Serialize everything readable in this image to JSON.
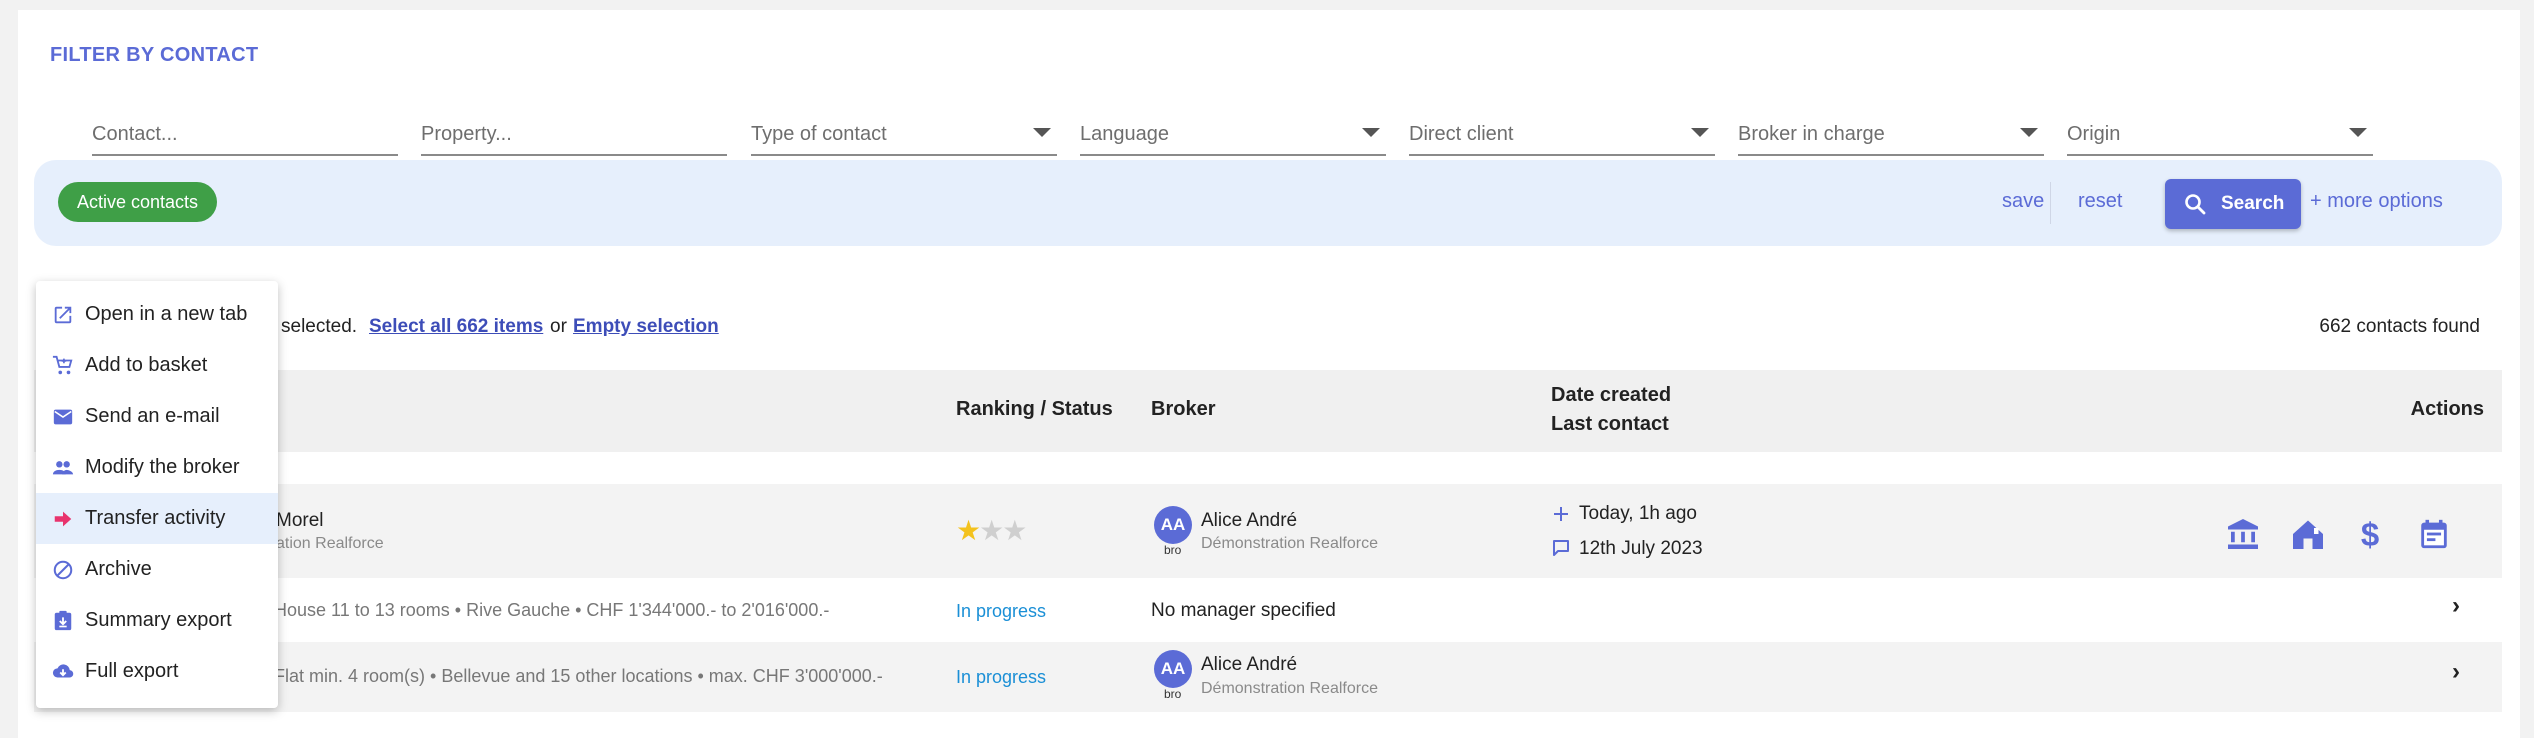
{
  "filter": {
    "title": "FILTER BY CONTACT",
    "fields": [
      {
        "placeholder": "Contact...",
        "dropdown": false
      },
      {
        "placeholder": "Property...",
        "dropdown": false
      },
      {
        "placeholder": "Type of contact",
        "dropdown": true
      },
      {
        "placeholder": "Language",
        "dropdown": true
      },
      {
        "placeholder": "Direct client",
        "dropdown": true
      },
      {
        "placeholder": "Broker in charge",
        "dropdown": true
      },
      {
        "placeholder": "Origin",
        "dropdown": true
      }
    ]
  },
  "actionbar": {
    "chip": "Active contacts",
    "save": "save",
    "reset": "reset",
    "search": "Search",
    "more": "+ more options"
  },
  "selection": {
    "text": "selected.",
    "select_all": "Select all 662 items",
    "or": "or",
    "empty": "Empty selection",
    "found": "662 contacts found"
  },
  "table": {
    "headers": {
      "ranking": "Ranking / Status",
      "broker": "Broker",
      "date_created": "Date created",
      "last_contact": "Last contact",
      "actions": "Actions"
    },
    "contact_row": {
      "name": "Morel",
      "company": "ation Realforce",
      "stars": 1,
      "broker_initials": "AA",
      "broker_role": "bro",
      "broker_name": "Alice André",
      "broker_agency": "Démonstration Realforce",
      "created": "Today, 1h ago",
      "last_contact": "12th July 2023"
    },
    "search_rows": [
      {
        "desc": "House 11 to 13 rooms • Rive Gauche • CHF 1'344'000.- to 2'016'000.-",
        "status": "In progress",
        "broker_text": "No manager specified",
        "has_broker": false
      },
      {
        "desc": "Flat min. 4 room(s) • Bellevue and 15 other locations • max. CHF 3'000'000.-",
        "status": "In progress",
        "broker_initials": "AA",
        "broker_role": "bro",
        "broker_name": "Alice André",
        "broker_agency": "Démonstration Realforce",
        "has_broker": true
      }
    ]
  },
  "context_menu": {
    "items": [
      {
        "label": "Open in a new tab",
        "icon": "open-in-new-icon"
      },
      {
        "label": "Add to basket",
        "icon": "basket-icon"
      },
      {
        "label": "Send an e-mail",
        "icon": "mail-icon"
      },
      {
        "label": "Modify the broker",
        "icon": "people-icon"
      },
      {
        "label": "Transfer activity",
        "icon": "arrow-right-icon",
        "highlighted": true
      },
      {
        "label": "Archive",
        "icon": "archive-block-icon"
      },
      {
        "label": "Summary export",
        "icon": "summary-export-icon"
      },
      {
        "label": "Full export",
        "icon": "cloud-download-icon"
      }
    ]
  },
  "colors": {
    "accent": "#5b6bd6",
    "chip": "#3f9f47",
    "status": "#1a8fd6",
    "star": "#f3c21d",
    "transfer": "#e8336d"
  }
}
